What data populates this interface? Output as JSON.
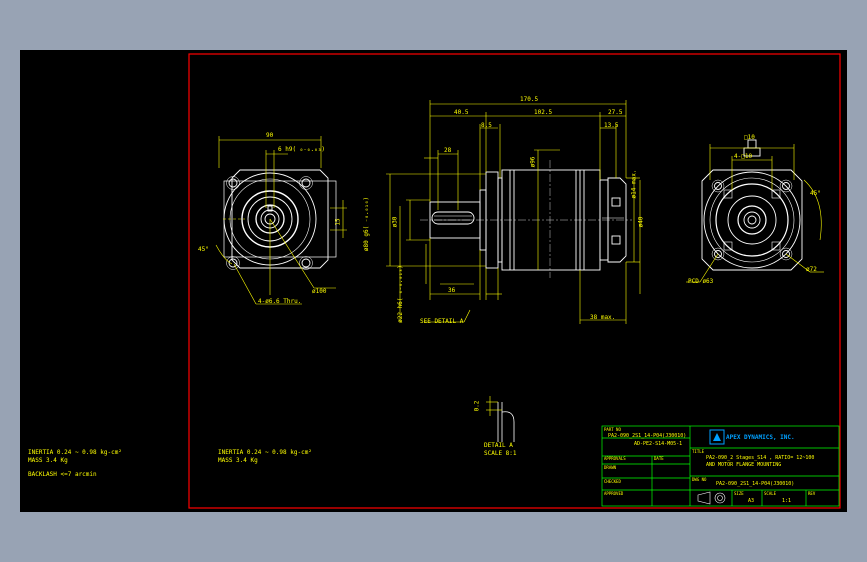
{
  "colors": {
    "background_outer": "#98a3b4",
    "canvas": "#000000",
    "border": "#ff0000",
    "geometry": "#ffffff",
    "dimensions": "#ffff00",
    "title_block": "#00ff00",
    "logo": "#00a0ff"
  },
  "left_notes": {
    "inertia": "INERTIA 0.24 ~ 0.98 kg-cm²",
    "mass": "MASS 3.4 Kg",
    "backlash": "BACKLASH <=7 arcmin"
  },
  "inner_notes": {
    "inertia": "INERTIA 0.24 ~ 0.98 kg-cm²",
    "mass": "MASS 3.4 Kg"
  },
  "front_view": {
    "dim_top": "90",
    "dim_key": "6 h9( ₀₋₀.₀₃)",
    "dim_right": "15",
    "dim_angle": "45°",
    "dim_holes": "4-ø6.6 Thru.",
    "dim_pcd": "ø100"
  },
  "side_view": {
    "dim_overall": "170.5",
    "dim_left": "40.5",
    "dim_mid": "102.5",
    "dim_right": "27.5",
    "dim_small_a": "8.5",
    "dim_small_b": "13.5",
    "dim_shaft_len": "36",
    "dim_key_len": "28",
    "dim_flange": "ø80 g6( ₋₀.₀₁₀)",
    "dim_bore": "ø30",
    "dim_shaft": "ø22 h6( ₀₋₀.₀₁₃)",
    "dim_body": "ø96",
    "dim_input": "ø14 max.",
    "dim_input_b": "ø40",
    "dim_input_len": "38 max.",
    "detail_ref": "SEE DETAIL A"
  },
  "rear_view": {
    "dim_top": "□10",
    "dim_width": "4-□10",
    "dim_angle": "45°",
    "dim_outer": "ø72",
    "dim_pcd": "PCD ø63"
  },
  "detail": {
    "title": "DETAIL A",
    "scale": "SCALE 8:1",
    "dim": "0.2"
  },
  "title_block": {
    "part_no_label": "PART NO",
    "part_no_line1": "PA2-090_2S1_14-P04(J30010)",
    "part_no_line2": "AD-PE2-S14-M05-1",
    "approvals_label": "APPROVALS",
    "date_label": "DATE",
    "drawn_label": "DRAWN",
    "checked_label": "CHECKED",
    "approved_label": "APPROVED",
    "company": "APEX DYNAMICS, INC.",
    "title_label": "TITLE",
    "title_line1": "PA2-090_2 Stages_S14 , RATIO= 12~100",
    "title_line2": "AND MOTOR FLANGE MOUNTING",
    "dwg_label": "DWG NO",
    "dwg_no": "PA2-090_2S1_14-P04(J30010)",
    "size_label": "SIZE",
    "size": "A3",
    "scale_label": "SCALE",
    "scale": "1:1",
    "rev_label": "REV"
  }
}
